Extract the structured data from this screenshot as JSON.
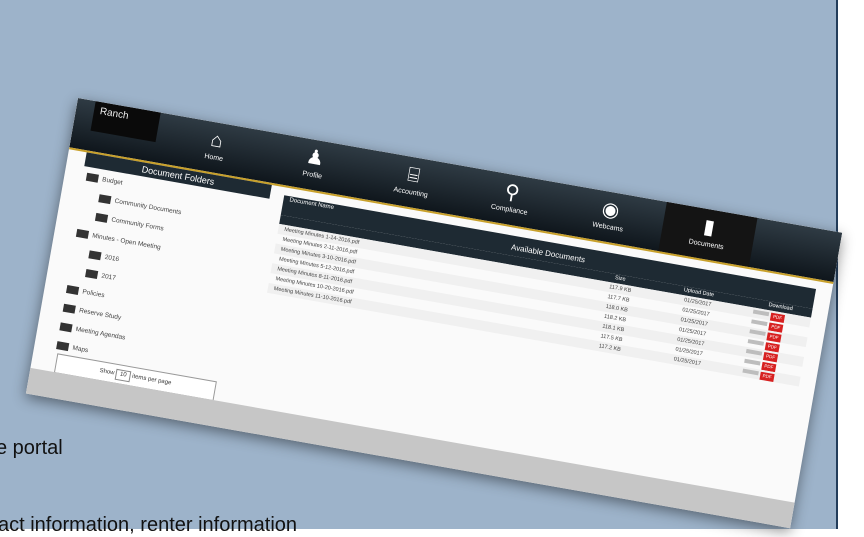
{
  "app": {
    "brand": "Ranch"
  },
  "nav": [
    {
      "label": "Home",
      "icon": "home-icon",
      "glyph": "⌂"
    },
    {
      "label": "Profile",
      "icon": "person-icon",
      "glyph": "♟"
    },
    {
      "label": "Accounting",
      "icon": "bank-icon",
      "glyph": "⌸"
    },
    {
      "label": "Compliance",
      "icon": "magnifier-icon",
      "glyph": "⚲"
    },
    {
      "label": "Webcams",
      "icon": "webcam-icon",
      "glyph": "◉"
    },
    {
      "label": "Documents",
      "icon": "document-icon",
      "glyph": "▮"
    }
  ],
  "folders_title": "Document Folders",
  "folders": [
    {
      "name": "Budget",
      "indent": false
    },
    {
      "name": "Community Documents",
      "indent": true
    },
    {
      "name": "Community Forms",
      "indent": true
    },
    {
      "name": "Minutes - Open Meeting",
      "indent": false
    },
    {
      "name": "2016",
      "indent": true
    },
    {
      "name": "2017",
      "indent": true
    },
    {
      "name": "Policies",
      "indent": false
    },
    {
      "name": "Reserve Study",
      "indent": false
    },
    {
      "name": "Meeting Agendas",
      "indent": false
    },
    {
      "name": "Maps",
      "indent": false
    }
  ],
  "per_page": {
    "before": "Show",
    "value": "10",
    "after": "items per page"
  },
  "documents": {
    "title": "Available Documents",
    "columns": {
      "name": "Document Name",
      "size": "Size",
      "date": "Upload Date",
      "download": "Download"
    },
    "rows": [
      {
        "name": "Meeting Minutes 1-14-2016.pdf",
        "size": "117.9 KB",
        "date": "01/25/2017"
      },
      {
        "name": "Meeting Minutes 2-11-2016.pdf",
        "size": "117.7 KB",
        "date": "01/25/2017"
      },
      {
        "name": "Meeting Minutes 3-10-2016.pdf",
        "size": "118.0 KB",
        "date": "01/25/2017"
      },
      {
        "name": "Meeting Minutes 5-12-2016.pdf",
        "size": "118.2 KB",
        "date": "01/25/2017"
      },
      {
        "name": "Meeting Minutes 8-11-2016.pdf",
        "size": "118.1 KB",
        "date": "01/25/2017"
      },
      {
        "name": "Meeting Minutes 10-20-2016.pdf",
        "size": "117.5 KB",
        "date": "01/25/2017"
      },
      {
        "name": "Meeting Minutes 11-10-2016.pdf",
        "size": "117.2 KB",
        "date": "01/25/2017"
      }
    ],
    "download_label": "PDF"
  },
  "captions": {
    "line1": "e portal",
    "line2": "act information, renter information"
  },
  "colors": {
    "slide": "#9db3ca",
    "topbar": "#1e2a33",
    "gold": "#c8a02a",
    "pdf": "#d72020"
  }
}
